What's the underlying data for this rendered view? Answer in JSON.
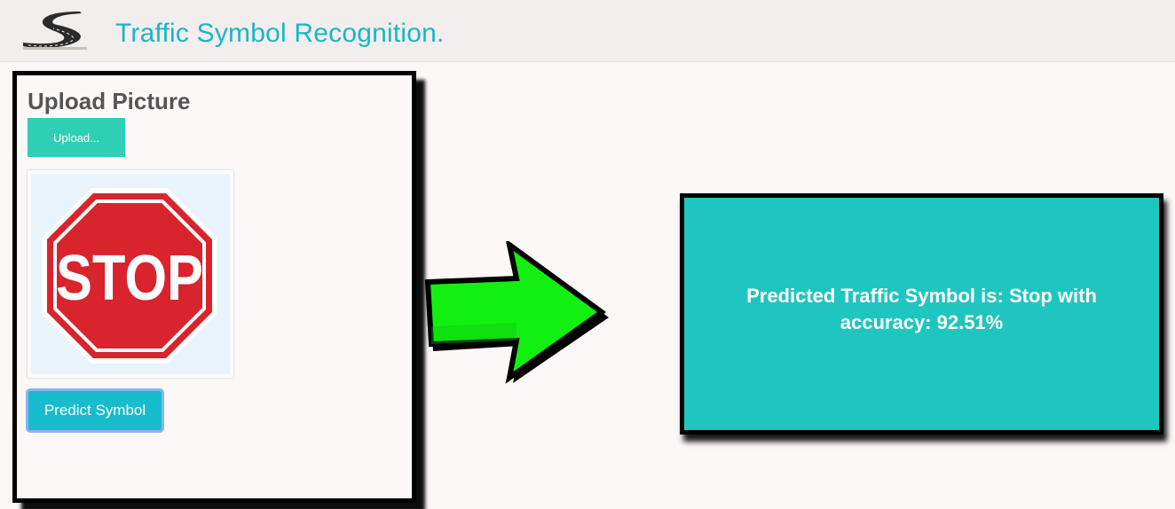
{
  "header": {
    "title": "Traffic Symbol Recognition.",
    "logo_icon": "road-logo-icon"
  },
  "upload_panel": {
    "title": "Upload Picture",
    "upload_button_label": "Upload...",
    "preview_image": {
      "icon": "stop-sign-image",
      "sign_text": "STOP"
    },
    "predict_button_label": "Predict Symbol"
  },
  "arrow": {
    "icon": "right-arrow-icon",
    "color": "#12f012"
  },
  "result": {
    "text": "Predicted Traffic Symbol is: Stop with accuracy: 92.51%",
    "background_color": "#1fc6bf"
  },
  "colors": {
    "title": "#1ab6c6",
    "upload_button": "#2ecfb5",
    "predict_button": "#17bccd",
    "stop_red": "#d9232d"
  }
}
